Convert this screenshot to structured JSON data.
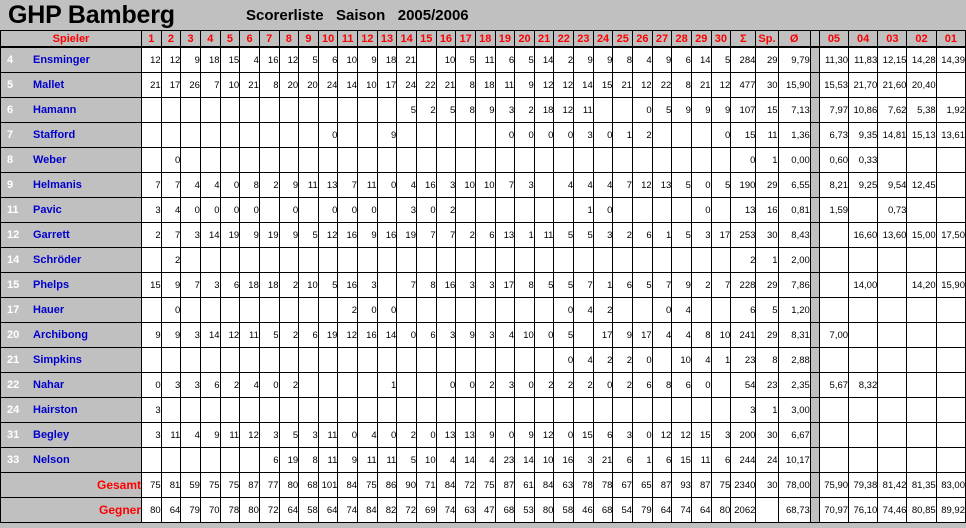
{
  "header": {
    "team": "GHP Bamberg",
    "subtitle": "Scorerliste   Saison   2005/2006",
    "player_col_label": "Spieler",
    "game_columns": [
      "1",
      "2",
      "3",
      "4",
      "5",
      "6",
      "7",
      "8",
      "9",
      "10",
      "11",
      "12",
      "13",
      "14",
      "15",
      "16",
      "17",
      "18",
      "19",
      "20",
      "21",
      "22",
      "23",
      "24",
      "25",
      "26",
      "27",
      "28",
      "29",
      "30"
    ],
    "sum_label": "Σ",
    "games_label": "Sp.",
    "avg_label": "Ø",
    "season_columns": [
      "05",
      "04",
      "03",
      "02",
      "01"
    ]
  },
  "colors": {
    "header_text": "#ff0000",
    "player_name": "#0000cc",
    "player_number": "#ffffff",
    "total_row_text": "#ff0000",
    "grid_background": "#c0c0c0",
    "cell_background": "#ffffff"
  },
  "rows": [
    {
      "number": "4",
      "name": "Ensminger",
      "games": [
        "12",
        "12",
        "9",
        "18",
        "15",
        "4",
        "16",
        "12",
        "5",
        "6",
        "10",
        "9",
        "18",
        "21",
        "",
        "10",
        "5",
        "11",
        "6",
        "5",
        "14",
        "2",
        "9",
        "9",
        "8",
        "4",
        "9",
        "6",
        "14",
        "5"
      ],
      "sum": "284",
      "played": "29",
      "avg": "9,79",
      "seasons": [
        "11,30",
        "11,83",
        "12,15",
        "14,28",
        "14,39"
      ]
    },
    {
      "number": "5",
      "name": "Mallet",
      "games": [
        "21",
        "17",
        "26",
        "7",
        "10",
        "21",
        "8",
        "20",
        "20",
        "24",
        "14",
        "10",
        "17",
        "24",
        "22",
        "21",
        "8",
        "18",
        "11",
        "9",
        "12",
        "12",
        "14",
        "15",
        "21",
        "12",
        "22",
        "8",
        "21",
        "12"
      ],
      "sum": "477",
      "played": "30",
      "avg": "15,90",
      "seasons": [
        "15,53",
        "21,70",
        "21,60",
        "20,40",
        ""
      ]
    },
    {
      "number": "6",
      "name": "Hamann",
      "games": [
        "",
        "",
        "",
        "",
        "",
        "",
        "",
        "",
        "",
        "",
        "",
        "",
        "",
        "5",
        "2",
        "5",
        "8",
        "9",
        "3",
        "2",
        "18",
        "12",
        "11",
        "",
        "",
        "0",
        "5",
        "9",
        "9",
        "9"
      ],
      "sum": "107",
      "played": "15",
      "avg": "7,13",
      "seasons": [
        "7,97",
        "10,86",
        "7,62",
        "5,38",
        "1,92"
      ]
    },
    {
      "number": "7",
      "name": "Stafford",
      "games": [
        "",
        "",
        "",
        "",
        "",
        "",
        "",
        "",
        "",
        "0",
        "",
        "",
        "9",
        "",
        "",
        "",
        "",
        "",
        "0",
        "0",
        "0",
        "0",
        "3",
        "0",
        "1",
        "2",
        "",
        "",
        "",
        "0"
      ],
      "sum": "15",
      "played": "11",
      "avg": "1,36",
      "seasons": [
        "6,73",
        "9,35",
        "14,81",
        "15,13",
        "13,61"
      ]
    },
    {
      "number": "8",
      "name": "Weber",
      "games": [
        "",
        "0",
        "",
        "",
        "",
        "",
        "",
        "",
        "",
        "",
        "",
        "",
        "",
        "",
        "",
        "",
        "",
        "",
        "",
        "",
        "",
        "",
        "",
        "",
        "",
        "",
        "",
        "",
        "",
        ""
      ],
      "sum": "0",
      "played": "1",
      "avg": "0,00",
      "seasons": [
        "0,60",
        "0,33",
        "",
        "",
        ""
      ]
    },
    {
      "number": "9",
      "name": "Helmanis",
      "games": [
        "7",
        "7",
        "4",
        "4",
        "0",
        "8",
        "2",
        "9",
        "11",
        "13",
        "7",
        "11",
        "0",
        "4",
        "16",
        "3",
        "10",
        "10",
        "7",
        "3",
        "",
        "4",
        "4",
        "4",
        "7",
        "12",
        "13",
        "5",
        "0",
        "5"
      ],
      "sum": "190",
      "played": "29",
      "avg": "6,55",
      "seasons": [
        "8,21",
        "9,25",
        "9,54",
        "12,45",
        ""
      ]
    },
    {
      "number": "11",
      "name": "Pavic",
      "games": [
        "3",
        "4",
        "0",
        "0",
        "0",
        "0",
        "",
        "0",
        "",
        "0",
        "0",
        "0",
        "",
        "3",
        "0",
        "2",
        "",
        "",
        "",
        "",
        "",
        "",
        "1",
        "0",
        "",
        "",
        "",
        "",
        "0",
        ""
      ],
      "sum": "13",
      "played": "16",
      "avg": "0,81",
      "seasons": [
        "1,59",
        "",
        "0,73",
        "",
        ""
      ]
    },
    {
      "number": "12",
      "name": "Garrett",
      "games": [
        "2",
        "7",
        "3",
        "14",
        "19",
        "9",
        "19",
        "9",
        "5",
        "12",
        "16",
        "9",
        "16",
        "19",
        "7",
        "7",
        "2",
        "6",
        "13",
        "1",
        "11",
        "5",
        "5",
        "3",
        "2",
        "6",
        "1",
        "5",
        "3",
        "17"
      ],
      "sum": "253",
      "played": "30",
      "avg": "8,43",
      "seasons": [
        "",
        "16,60",
        "13,60",
        "15,00",
        "17,50"
      ]
    },
    {
      "number": "14",
      "name": "Schröder",
      "games": [
        "",
        "2",
        "",
        "",
        "",
        "",
        "",
        "",
        "",
        "",
        "",
        "",
        "",
        "",
        "",
        "",
        "",
        "",
        "",
        "",
        "",
        "",
        "",
        "",
        "",
        "",
        "",
        "",
        "",
        ""
      ],
      "sum": "2",
      "played": "1",
      "avg": "2,00",
      "seasons": [
        "",
        "",
        "",
        "",
        ""
      ]
    },
    {
      "number": "15",
      "name": "Phelps",
      "games": [
        "15",
        "9",
        "7",
        "3",
        "6",
        "18",
        "18",
        "2",
        "10",
        "5",
        "16",
        "3",
        "",
        "7",
        "8",
        "16",
        "3",
        "3",
        "17",
        "8",
        "5",
        "5",
        "7",
        "1",
        "6",
        "5",
        "7",
        "9",
        "2",
        "7"
      ],
      "sum": "228",
      "played": "29",
      "avg": "7,86",
      "seasons": [
        "",
        "14,00",
        "",
        "14,20",
        "15,90"
      ]
    },
    {
      "number": "17",
      "name": "Hauer",
      "games": [
        "",
        "0",
        "",
        "",
        "",
        "",
        "",
        "",
        "",
        "",
        "2",
        "0",
        "0",
        "",
        "",
        "",
        "",
        "",
        "",
        "",
        "",
        "0",
        "4",
        "2",
        "",
        "",
        "0",
        "4",
        "",
        ""
      ],
      "sum": "6",
      "played": "5",
      "avg": "1,20",
      "seasons": [
        "",
        "",
        "",
        "",
        ""
      ]
    },
    {
      "number": "20",
      "name": "Archibong",
      "games": [
        "9",
        "9",
        "3",
        "14",
        "12",
        "11",
        "5",
        "2",
        "6",
        "19",
        "12",
        "16",
        "14",
        "0",
        "6",
        "3",
        "9",
        "3",
        "4",
        "10",
        "0",
        "5",
        "",
        "17",
        "9",
        "17",
        "4",
        "4",
        "8",
        "10"
      ],
      "sum": "241",
      "played": "29",
      "avg": "8,31",
      "seasons": [
        "7,00",
        "",
        "",
        "",
        ""
      ]
    },
    {
      "number": "21",
      "name": "Simpkins",
      "games": [
        "",
        "",
        "",
        "",
        "",
        "",
        "",
        "",
        "",
        "",
        "",
        "",
        "",
        "",
        "",
        "",
        "",
        "",
        "",
        "",
        "",
        "0",
        "4",
        "2",
        "2",
        "0",
        "",
        "10",
        "4",
        "1"
      ],
      "sum": "23",
      "played": "8",
      "avg": "2,88",
      "seasons": [
        "",
        "",
        "",
        "",
        ""
      ]
    },
    {
      "number": "22",
      "name": "Nahar",
      "games": [
        "0",
        "3",
        "3",
        "6",
        "2",
        "4",
        "0",
        "2",
        "",
        "",
        "",
        "",
        "1",
        "",
        "",
        "0",
        "0",
        "2",
        "3",
        "0",
        "2",
        "2",
        "2",
        "0",
        "2",
        "6",
        "8",
        "6",
        "0",
        ""
      ],
      "sum": "54",
      "played": "23",
      "avg": "2,35",
      "seasons": [
        "5,67",
        "8,32",
        "",
        "",
        ""
      ]
    },
    {
      "number": "24",
      "name": "Hairston",
      "games": [
        "3",
        "",
        "",
        "",
        "",
        "",
        "",
        "",
        "",
        "",
        "",
        "",
        "",
        "",
        "",
        "",
        "",
        "",
        "",
        "",
        "",
        "",
        "",
        "",
        "",
        "",
        "",
        "",
        "",
        ""
      ],
      "sum": "3",
      "played": "1",
      "avg": "3,00",
      "seasons": [
        "",
        "",
        "",
        "",
        ""
      ]
    },
    {
      "number": "31",
      "name": "Begley",
      "games": [
        "3",
        "11",
        "4",
        "9",
        "11",
        "12",
        "3",
        "5",
        "3",
        "11",
        "0",
        "4",
        "0",
        "2",
        "0",
        "13",
        "13",
        "9",
        "0",
        "9",
        "12",
        "0",
        "15",
        "6",
        "3",
        "0",
        "12",
        "12",
        "15",
        "3"
      ],
      "sum": "200",
      "played": "30",
      "avg": "6,67",
      "seasons": [
        "",
        "",
        "",
        "",
        ""
      ]
    },
    {
      "number": "33",
      "name": "Nelson",
      "games": [
        "",
        "",
        "",
        "",
        "",
        "",
        "6",
        "19",
        "8",
        "11",
        "9",
        "11",
        "11",
        "5",
        "10",
        "4",
        "14",
        "4",
        "23",
        "14",
        "10",
        "16",
        "3",
        "21",
        "6",
        "1",
        "6",
        "15",
        "11",
        "6"
      ],
      "sum": "244",
      "played": "24",
      "avg": "10,17",
      "seasons": [
        "",
        "",
        "",
        "",
        ""
      ]
    }
  ],
  "totals": [
    {
      "label": "Gesamt",
      "games": [
        "75",
        "81",
        "59",
        "75",
        "75",
        "87",
        "77",
        "80",
        "68",
        "101",
        "84",
        "75",
        "86",
        "90",
        "71",
        "84",
        "72",
        "75",
        "87",
        "61",
        "84",
        "63",
        "78",
        "78",
        "67",
        "65",
        "87",
        "93",
        "87",
        "75"
      ],
      "sum": "2340",
      "played": "30",
      "avg": "78,00",
      "seasons": [
        "75,90",
        "79,38",
        "81,42",
        "81,35",
        "83,00"
      ]
    },
    {
      "label": "Gegner",
      "games": [
        "80",
        "64",
        "79",
        "70",
        "78",
        "80",
        "72",
        "64",
        "58",
        "64",
        "74",
        "84",
        "82",
        "72",
        "69",
        "74",
        "63",
        "47",
        "68",
        "53",
        "80",
        "58",
        "46",
        "68",
        "54",
        "79",
        "64",
        "74",
        "64",
        "80"
      ],
      "sum": "2062",
      "played": "",
      "avg": "68,73",
      "seasons": [
        "70,97",
        "76,10",
        "74,46",
        "80,85",
        "89,92"
      ]
    }
  ]
}
